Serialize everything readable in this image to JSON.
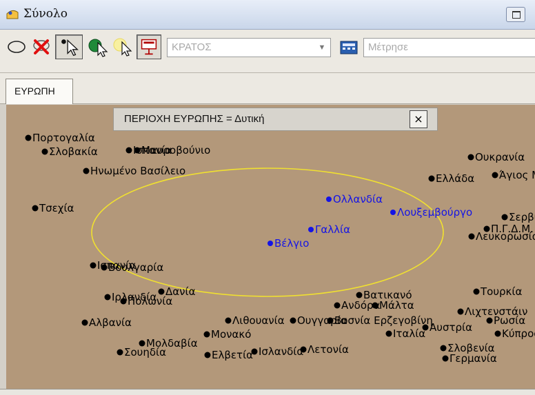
{
  "window": {
    "title": "Σύνολο",
    "icon": "set-folder-icon"
  },
  "toolbar": {
    "icons": [
      "ellipse-select-icon",
      "clear-selection-icon",
      "pointer-select-icon",
      "add-to-set-icon",
      "pointer-highlight-icon",
      "show-data-icon",
      "calculator-icon"
    ],
    "attribute_combo": {
      "value": "ΚΡΑΤΟΣ"
    },
    "measure_combo": {
      "value": "Μέτρησε"
    }
  },
  "tabs": [
    {
      "label": "ΕΥΡΩΠΗ",
      "active": true
    }
  ],
  "popup": {
    "label": "ΠΕΡΙΟΧΗ ΕΥΡΩΠΗΣ = Δυτική",
    "close": "×"
  },
  "colors": {
    "map_background": "#b3987a",
    "selected_point": "#1414e6",
    "unselected_point": "#000000",
    "selection_ellipse": "#f0e030"
  },
  "map": {
    "countries": [
      {
        "name": "Πορτογαλία",
        "selected": false
      },
      {
        "name": "Σλοβακία",
        "selected": false
      },
      {
        "name": "Ισπανία",
        "selected": false
      },
      {
        "name": "Μαυροβούνιο",
        "selected": false
      },
      {
        "name": "Ουκρανία",
        "selected": false
      },
      {
        "name": "Ηνωμένο Βασίλειο",
        "selected": false
      },
      {
        "name": "Ελλάδα",
        "selected": false
      },
      {
        "name": "Άγιος Μαρίνος",
        "selected": false
      },
      {
        "name": "Τσεχία",
        "selected": false
      },
      {
        "name": "Ολλανδία",
        "selected": true
      },
      {
        "name": "Λουξεμβούργο",
        "selected": true
      },
      {
        "name": "Σερβία",
        "selected": false
      },
      {
        "name": "Π.Γ.Δ.Μ.",
        "selected": false
      },
      {
        "name": "Λευκορωσία",
        "selected": false
      },
      {
        "name": "Γαλλία",
        "selected": true
      },
      {
        "name": "Βέλγιο",
        "selected": true
      },
      {
        "name": "Ισπανία",
        "selected": false
      },
      {
        "name": "Βουλγαρία",
        "selected": false
      },
      {
        "name": "Ιρλανδία",
        "selected": false
      },
      {
        "name": "Δανία",
        "selected": false
      },
      {
        "name": "Πολωνία",
        "selected": false
      },
      {
        "name": "Βατικανό",
        "selected": false
      },
      {
        "name": "Τουρκία",
        "selected": false
      },
      {
        "name": "Ανδόρα",
        "selected": false
      },
      {
        "name": "Μάλτα",
        "selected": false
      },
      {
        "name": "Λιχτενστάιν",
        "selected": false
      },
      {
        "name": "Αλβανία",
        "selected": false
      },
      {
        "name": "Λιθουανία",
        "selected": false
      },
      {
        "name": "Ουγγαρία",
        "selected": false
      },
      {
        "name": "Βοσνία Ερζεγοβίνη",
        "selected": false
      },
      {
        "name": "Ρωσία",
        "selected": false
      },
      {
        "name": "Ιταλία",
        "selected": false
      },
      {
        "name": "Αυστρία",
        "selected": false
      },
      {
        "name": "Κύπρος",
        "selected": false
      },
      {
        "name": "Μολδαβία",
        "selected": false
      },
      {
        "name": "Μονακό",
        "selected": false
      },
      {
        "name": "Σουηδία",
        "selected": false
      },
      {
        "name": "Ελβετία",
        "selected": false
      },
      {
        "name": "Ισλανδία",
        "selected": false
      },
      {
        "name": "Λετονία",
        "selected": false
      },
      {
        "name": "Σλοβενία",
        "selected": false
      },
      {
        "name": "Γερμανία",
        "selected": false
      }
    ]
  }
}
